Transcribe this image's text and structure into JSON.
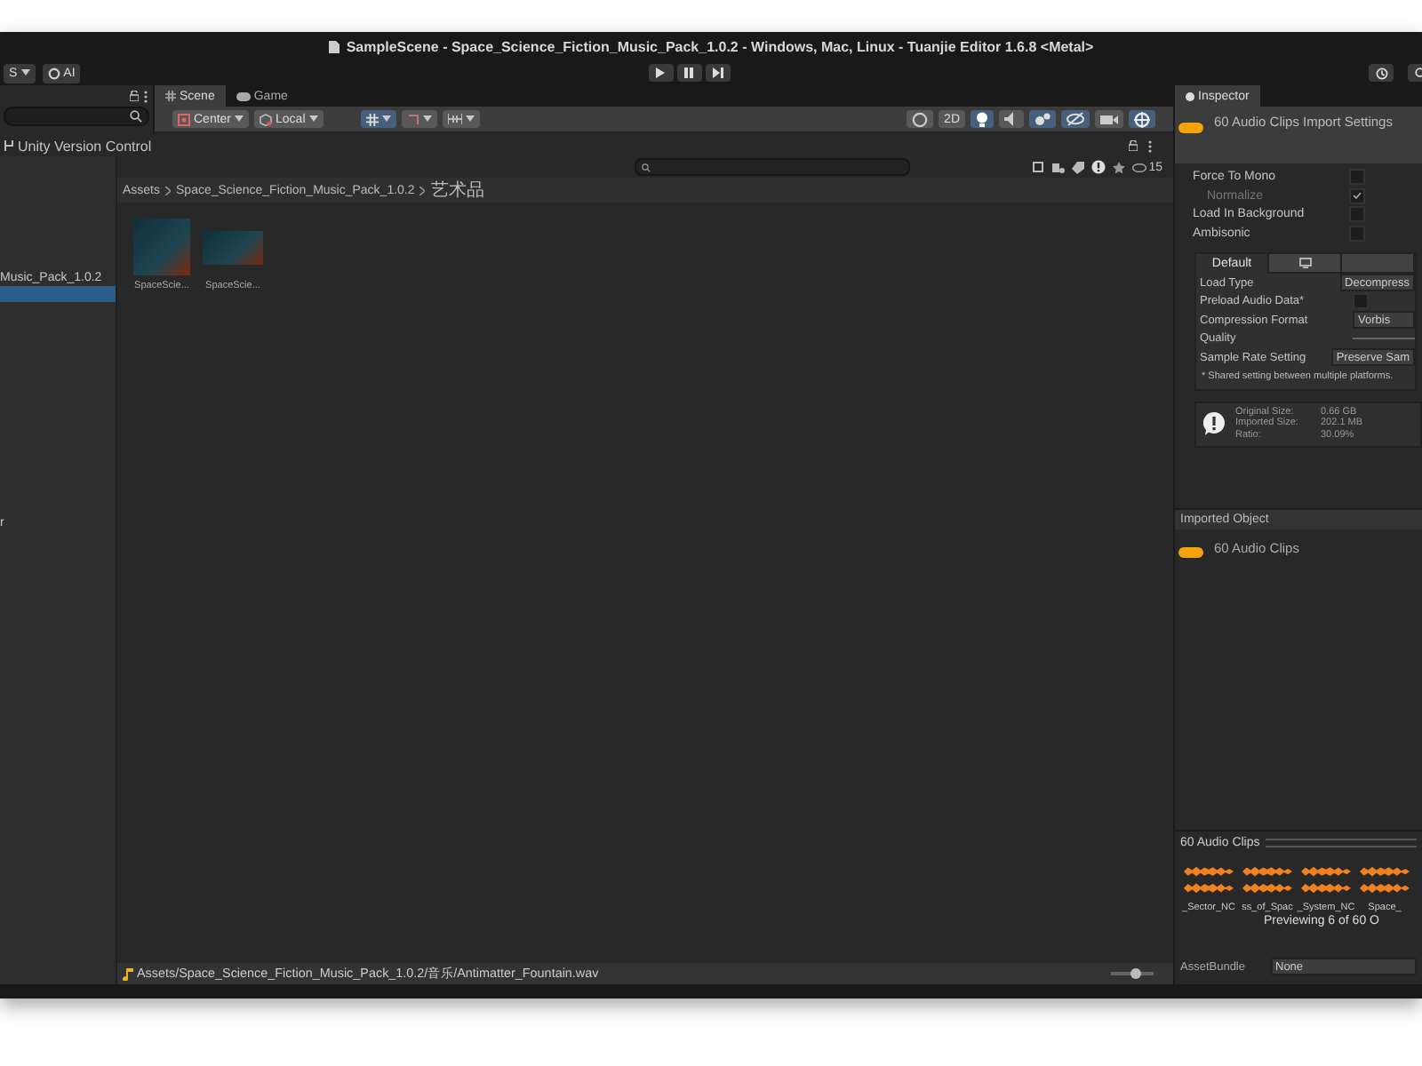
{
  "window": {
    "title": "SampleScene - Space_Science_Fiction_Music_Pack_1.0.2 - Windows, Mac, Linux - Tuanjie Editor 1.6.8 <Metal>"
  },
  "toolbar": {
    "account_label": "S",
    "ai_label": "AI"
  },
  "scene": {
    "tabs": [
      {
        "label": "Scene",
        "selected": true,
        "kind": "scene"
      },
      {
        "label": "Game",
        "selected": false,
        "kind": "game"
      }
    ],
    "pivot_buttons": [
      {
        "label": "Center",
        "kind": "center"
      },
      {
        "label": "Local",
        "kind": "local"
      }
    ],
    "view_toggles": [
      {
        "kind": "sphere",
        "active": false
      },
      {
        "kind": "text",
        "label": "2D",
        "active": false
      },
      {
        "kind": "light",
        "active": true
      },
      {
        "kind": "audio",
        "active": false
      },
      {
        "kind": "effects",
        "active": true
      },
      {
        "kind": "hidden",
        "active": true
      },
      {
        "kind": "camera",
        "active": false
      },
      {
        "kind": "gizmo",
        "active": true
      }
    ]
  },
  "project": {
    "version_control": "Unity Version Control",
    "tree": [
      {
        "label": "Music_Pack_1.0.2",
        "selected": false
      },
      {
        "selected": true
      },
      {
        "label": "r",
        "selected": false
      }
    ],
    "hidden_count": "15",
    "breadcrumb": [
      "Assets",
      "Space_Science_Fiction_Music_Pack_1.0.2",
      "艺术品"
    ],
    "assets": [
      {
        "label": "SpaceScie...",
        "kind": "square"
      },
      {
        "label": "SpaceScie...",
        "kind": "wide"
      }
    ],
    "path": "Assets/Space_Science_Fiction_Music_Pack_1.0.2/音乐/Antimatter_Fountain.wav",
    "zoom": {
      "level": 0.6
    }
  },
  "inspector": {
    "tab": "Inspector",
    "title": "60 Audio Clips Import Settings",
    "options": [
      {
        "label": "Force To Mono",
        "checked": false,
        "disabled": false
      },
      {
        "label": "Normalize",
        "checked": true,
        "disabled": true
      },
      {
        "label": "Load In Background",
        "checked": false,
        "disabled": false
      },
      {
        "label": "Ambisonic",
        "checked": false,
        "disabled": false
      }
    ],
    "platform_tabs": [
      {
        "label": "Default",
        "kind": "text",
        "selected": true
      },
      {
        "kind": "monitor",
        "selected": false
      },
      {
        "kind": "blank",
        "selected": false
      }
    ],
    "settings": [
      {
        "label": "Load Type",
        "kind": "dropdown",
        "value": "Decompress"
      },
      {
        "label": "Preload Audio Data*",
        "kind": "checkbox",
        "checked": false
      },
      {
        "label": "Compression Format",
        "kind": "dropdown",
        "value": "Vorbis"
      },
      {
        "label": "Quality",
        "kind": "slider"
      },
      {
        "label": "Sample Rate Setting",
        "kind": "dropdown",
        "value": "Preserve Sam"
      }
    ],
    "note": "* Shared setting between multiple platforms.",
    "sizes": [
      {
        "label": "Original Size:",
        "value": "0.66 GB"
      },
      {
        "label": "Imported Size:",
        "value": "202.1 MB"
      },
      {
        "label": "Ratio:",
        "value": "30.09%"
      }
    ],
    "imported_header": "Imported Object",
    "imported_name": "60 Audio Clips",
    "preview_header": "60 Audio Clips",
    "clips": [
      "_Sector_NC",
      "ss_of_Spac",
      "_System_NC",
      "Space_"
    ],
    "preview_note": "Previewing 6 of 60 O",
    "asset_bundle": {
      "label": "AssetBundle",
      "value": "None"
    }
  }
}
